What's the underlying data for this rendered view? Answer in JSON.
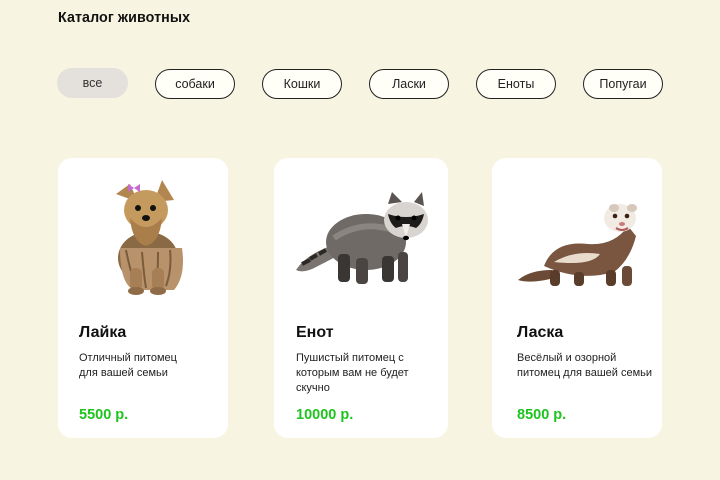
{
  "header": {
    "title": "Каталог животных"
  },
  "filters": [
    {
      "label": "все",
      "active": true
    },
    {
      "label": "собаки",
      "active": false
    },
    {
      "label": "Кошки",
      "active": false
    },
    {
      "label": "Ласки",
      "active": false
    },
    {
      "label": "Еноты",
      "active": false
    },
    {
      "label": "Попугаи",
      "active": false
    }
  ],
  "cards": [
    {
      "name": "Лайка",
      "description": "Отличный питомец\nдля вашей семьи",
      "price": "5500 р.",
      "image": "yorkshire-terrier-photo"
    },
    {
      "name": "Енот",
      "description": "Пушистый  питомец с\nкоторым вам не будет\nскучно",
      "price": "10000 р.",
      "image": "raccoon-photo"
    },
    {
      "name": "Ласка",
      "description": "Весёлый и озорной\nпитомец для вашей семьи",
      "price": "8500 р.",
      "image": "ferret-photo"
    }
  ],
  "colors": {
    "background": "#f7f4e1",
    "card": "#ffffff",
    "price": "#1ec41e",
    "active_chip": "#e4e1dc"
  }
}
